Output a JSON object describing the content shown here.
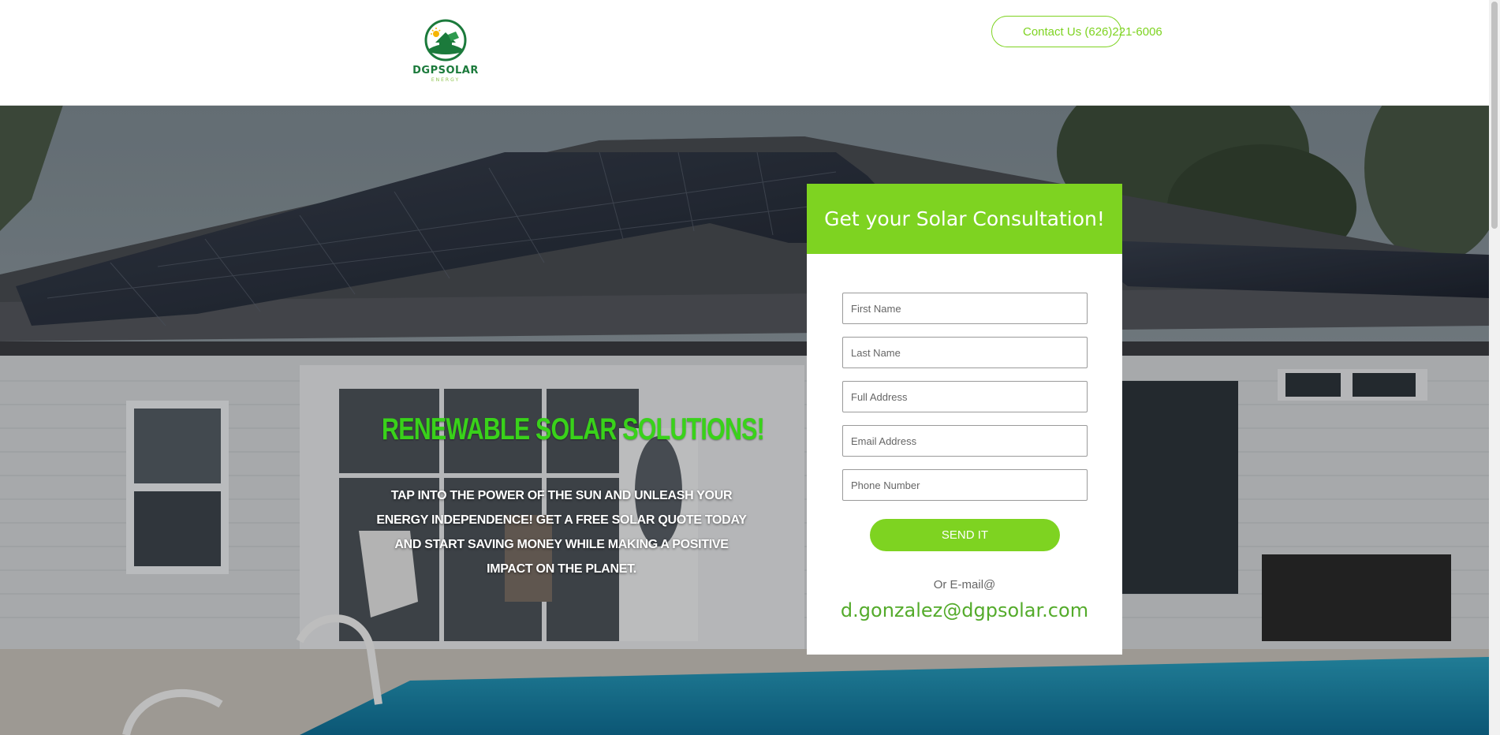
{
  "header": {
    "logo": {
      "name": "DGPSOLAR",
      "sub": "ENERGY",
      "icon": "house-solar-logo-icon"
    },
    "contact_button": "Contact Us (626)221-6006"
  },
  "hero": {
    "headline": "RENEWABLE SOLAR SOLUTIONS!",
    "subtext": "Tap into the power of the sun and unleash your energy independence! Get a free solar quote today and start saving money while making a positive impact on the planet."
  },
  "form": {
    "title": "Get your Solar Consultation!",
    "fields": {
      "first_name": "First Name",
      "last_name": "Last Name",
      "full_address": "Full Address",
      "email": "Email Address",
      "phone": "Phone Number"
    },
    "submit": "SEND IT",
    "or_email": "Or E-mail@",
    "email": "d.gonzalez@dgpsolar.com"
  },
  "colors": {
    "accent": "#7ed321",
    "headline": "#39d21a",
    "logo_green": "#1b7a3b"
  }
}
